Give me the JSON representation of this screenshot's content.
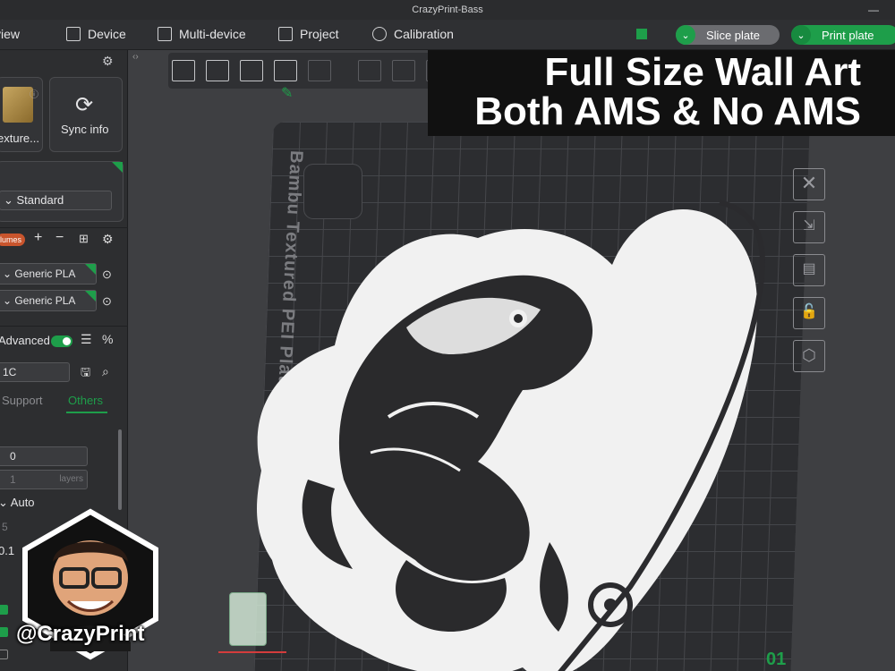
{
  "app": {
    "title": "CrazyPrint-Bass"
  },
  "menu": {
    "items": [
      {
        "label": "view",
        "icon": "view-icon"
      },
      {
        "label": "Device",
        "icon": "device-icon"
      },
      {
        "label": "Multi-device",
        "icon": "multi-device-icon"
      },
      {
        "label": "Project",
        "icon": "project-icon"
      },
      {
        "label": "Calibration",
        "icon": "calibration-icon"
      }
    ],
    "slice_label": "Slice plate",
    "print_label": "Print plate"
  },
  "sidebar": {
    "plate_type_label": "exture...",
    "sync_label": "Sync info",
    "process_preset": "Standard",
    "volumes_label": "lumes",
    "filaments": [
      "Generic PLA",
      "Generic PLA"
    ],
    "advanced_label": "Advanced",
    "preset_name": "1C",
    "tabs": [
      "Support",
      "Others"
    ],
    "value_0": "0",
    "value_layers": "1",
    "layers_unit": "layers",
    "auto_label": "Auto",
    "value_5": "5",
    "value_01": "0.1"
  },
  "viewport": {
    "plate_label": "Bambu Textured PEI Plate",
    "plate_number": "01"
  },
  "banner": {
    "line1": "Full Size Wall Art",
    "line2": "Both AMS & No AMS"
  },
  "watermark": {
    "handle": "@CrazyPrint"
  },
  "colors": {
    "accent": "#1e9e4a",
    "background": "#3e3f42",
    "sidebar": "#2d2e30"
  }
}
